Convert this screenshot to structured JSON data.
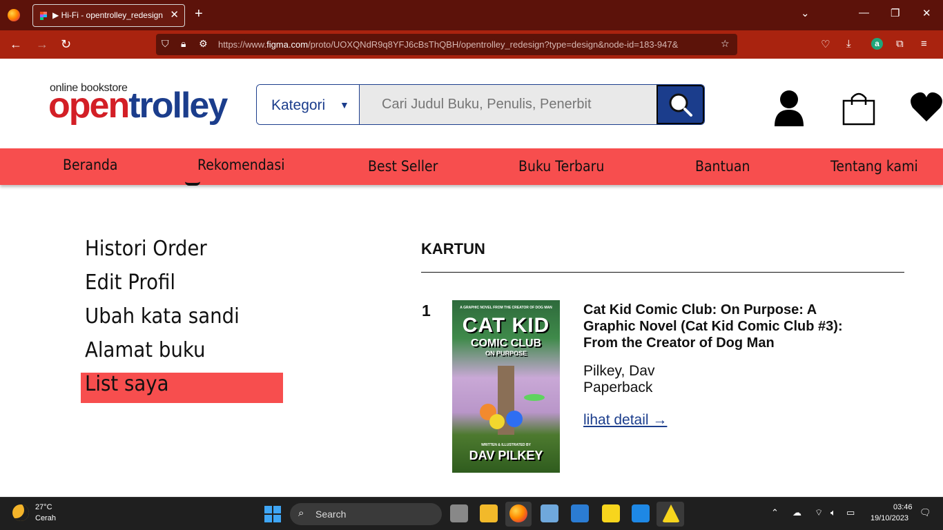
{
  "browser": {
    "tab_title": "▶ Hi-Fi - opentrolley_redesign",
    "tab_close": "✕",
    "new_tab": "+",
    "url_prefix": "https://www.",
    "url_domain": "figma.com",
    "url_rest": "/proto/UOXQNdR9q8YFJ6cBsThQBH/opentrolley_redesign?type=design&node-id=183-947&",
    "window_controls": [
      "⌄",
      "—",
      "❐",
      "✕"
    ]
  },
  "site": {
    "logo_small": "online bookstore",
    "logo_open": "open",
    "logo_trolley": "trolley",
    "category_label": "Kategori",
    "category_arrow": "▼",
    "search_placeholder": "Cari Judul Buku, Penulis, Penerbit",
    "colors": {
      "brand_blue": "#1b3d8c",
      "brand_red": "#f74e4e"
    }
  },
  "menu": [
    "Beranda",
    "Rekomendasi",
    "Best Seller",
    "Buku Terbaru",
    "Bantuan",
    "Tentang kami"
  ],
  "sidebar": [
    "Histori Order",
    "Edit Profil",
    "Ubah kata sandi",
    "Alamat buku",
    "List saya"
  ],
  "sidebar_active": "List saya",
  "list": {
    "section_title": "KARTUN",
    "items": [
      {
        "rank": "1",
        "title": "Cat Kid Comic Club: On Purpose: A Graphic Novel (Cat Kid Comic Club #3): From the Creator of Dog Man",
        "author": "Pilkey, Dav",
        "format": "Paperback",
        "link": "lihat detail →",
        "cover_top": "A GRAPHIC NOVEL FROM THE CREATOR OF DOG MAN",
        "cover_title1": "CAT KID",
        "cover_title2": "COMIC CLUB",
        "cover_subtitle": "ON PURPOSE",
        "cover_credit": "WRITTEN & ILLUSTRATED BY",
        "cover_author": "DAV PILKEY"
      }
    ]
  },
  "taskbar": {
    "temp": "27°C",
    "condition": "Cerah",
    "search": "Search",
    "time": "03:46",
    "date": "19/10/2023"
  }
}
